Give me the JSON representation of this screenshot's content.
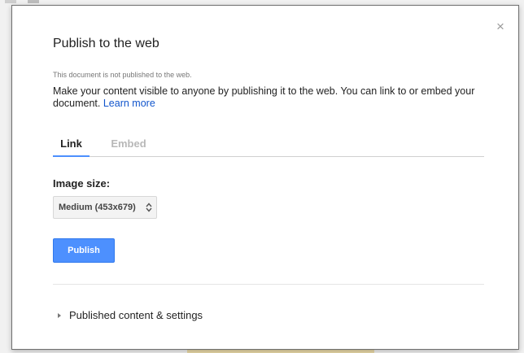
{
  "dialog": {
    "title": "Publish to the web",
    "close_icon": "×",
    "notice": "This document is not published to the web.",
    "description": "Make your content visible to anyone by publishing it to the web. You can link to or embed your document.",
    "learn_more": "Learn more"
  },
  "tabs": [
    {
      "label": "Link",
      "active": true
    },
    {
      "label": "Embed",
      "active": false
    }
  ],
  "image_size": {
    "label": "Image size:",
    "selected": "Medium (453x679)"
  },
  "publish_button": {
    "label": "Publish"
  },
  "settings_section": {
    "label": "Published content & settings",
    "expanded": false
  },
  "colors": {
    "accent_blue": "#4d90fe",
    "link_blue": "#1155cc",
    "inactive_tab": "#b8b8b8"
  },
  "icons": {
    "close": "close-icon",
    "select_arrows": "up-down-arrows-icon",
    "expand": "triangle-right-icon"
  }
}
